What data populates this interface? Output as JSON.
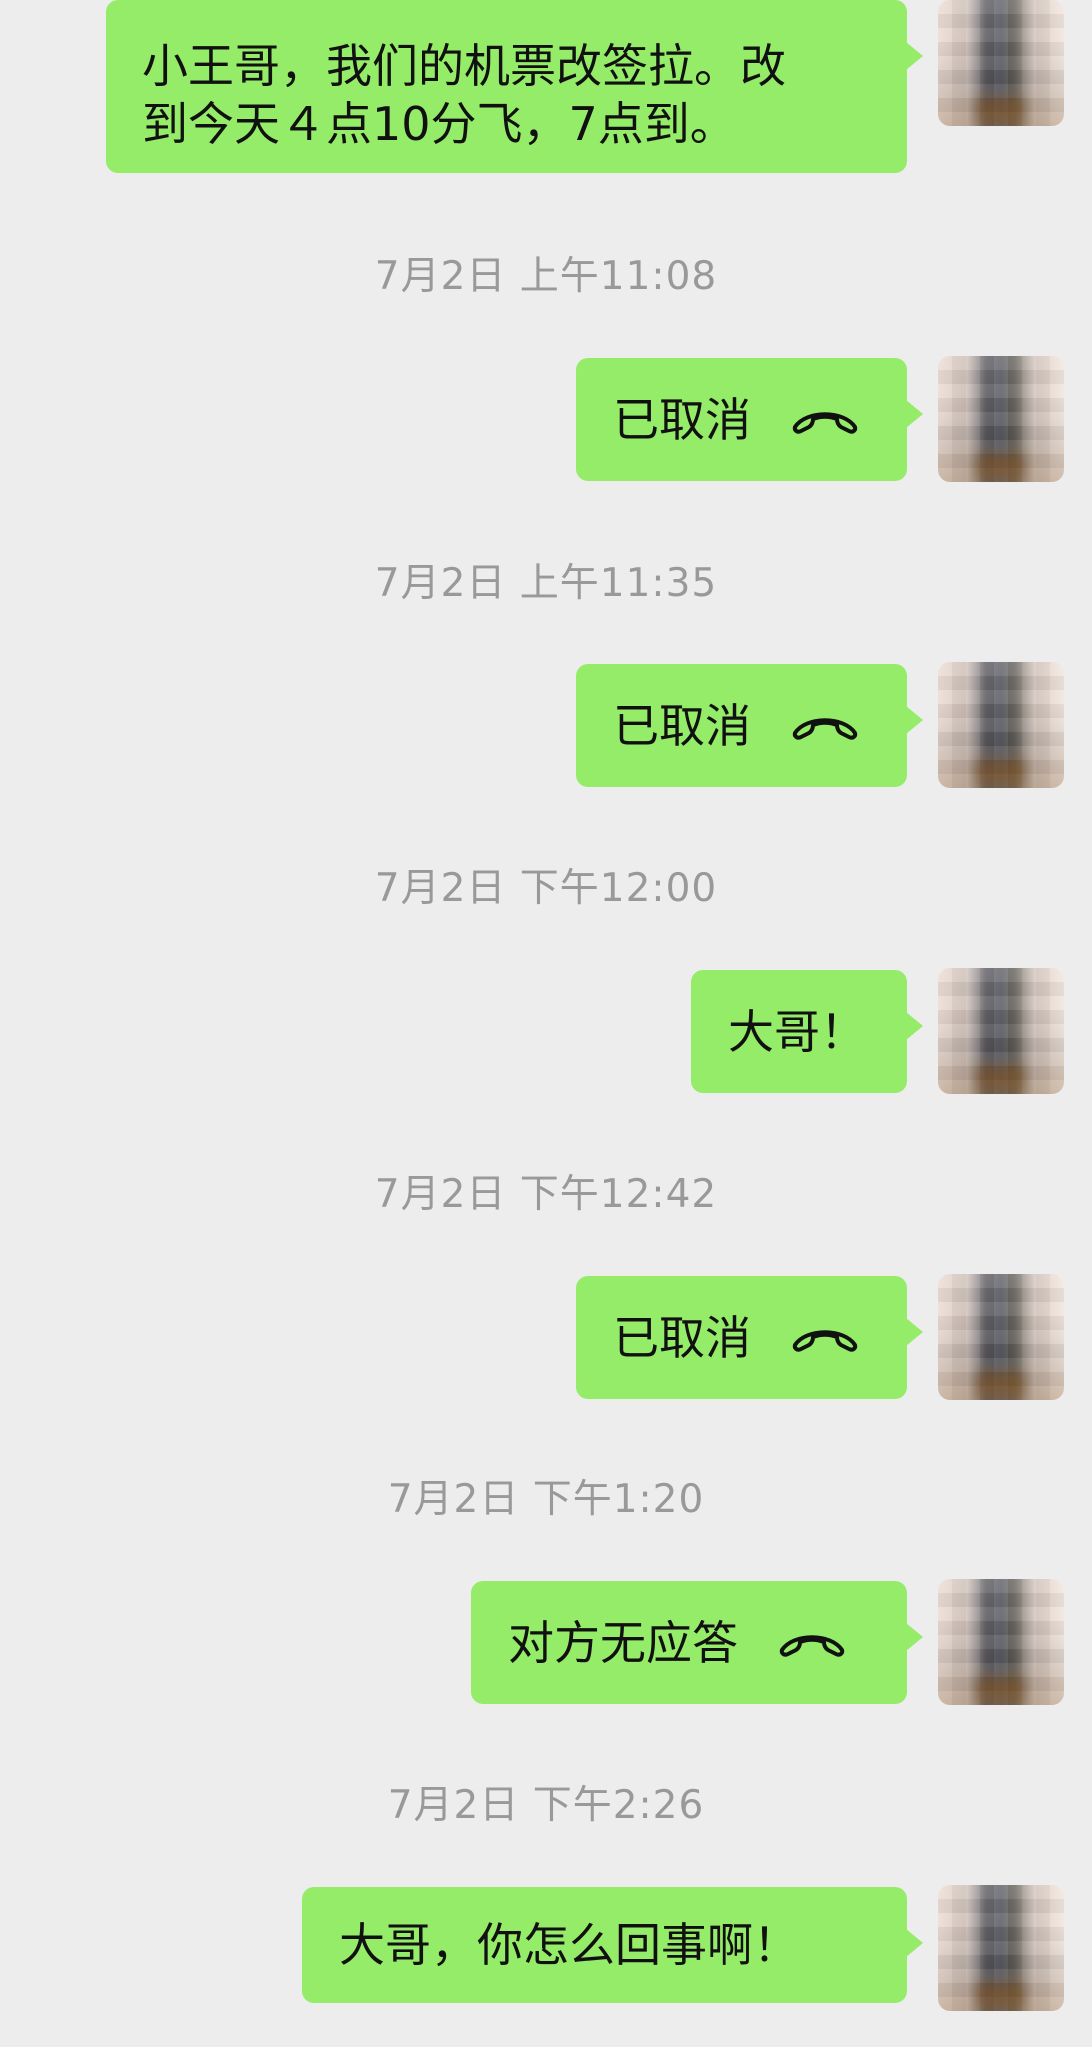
{
  "messages": [
    {
      "type": "text",
      "text": "小王哥，我们的机票改签拉。改\n到今天４点10分飞，7点到。"
    },
    {
      "type": "timestamp",
      "text": "7月2日 上午11:08"
    },
    {
      "type": "call",
      "text": "已取消",
      "icon": "phone-hangup-icon"
    },
    {
      "type": "timestamp",
      "text": "7月2日 上午11:35"
    },
    {
      "type": "call",
      "text": "已取消",
      "icon": "phone-hangup-icon"
    },
    {
      "type": "timestamp",
      "text": "7月2日 下午12:00"
    },
    {
      "type": "text",
      "text": "大哥！"
    },
    {
      "type": "timestamp",
      "text": "7月2日 下午12:42"
    },
    {
      "type": "call",
      "text": "已取消",
      "icon": "phone-hangup-icon"
    },
    {
      "type": "timestamp",
      "text": "7月2日 下午1:20"
    },
    {
      "type": "call",
      "text": "对方无应答",
      "icon": "phone-hangup-icon"
    },
    {
      "type": "timestamp",
      "text": "7月2日 下午2:26"
    },
    {
      "type": "text",
      "text": "大哥，你怎么回事啊！"
    }
  ],
  "colors": {
    "background": "#ededed",
    "bubble": "#95ec69",
    "text": "#111111",
    "timestamp": "#999999"
  }
}
